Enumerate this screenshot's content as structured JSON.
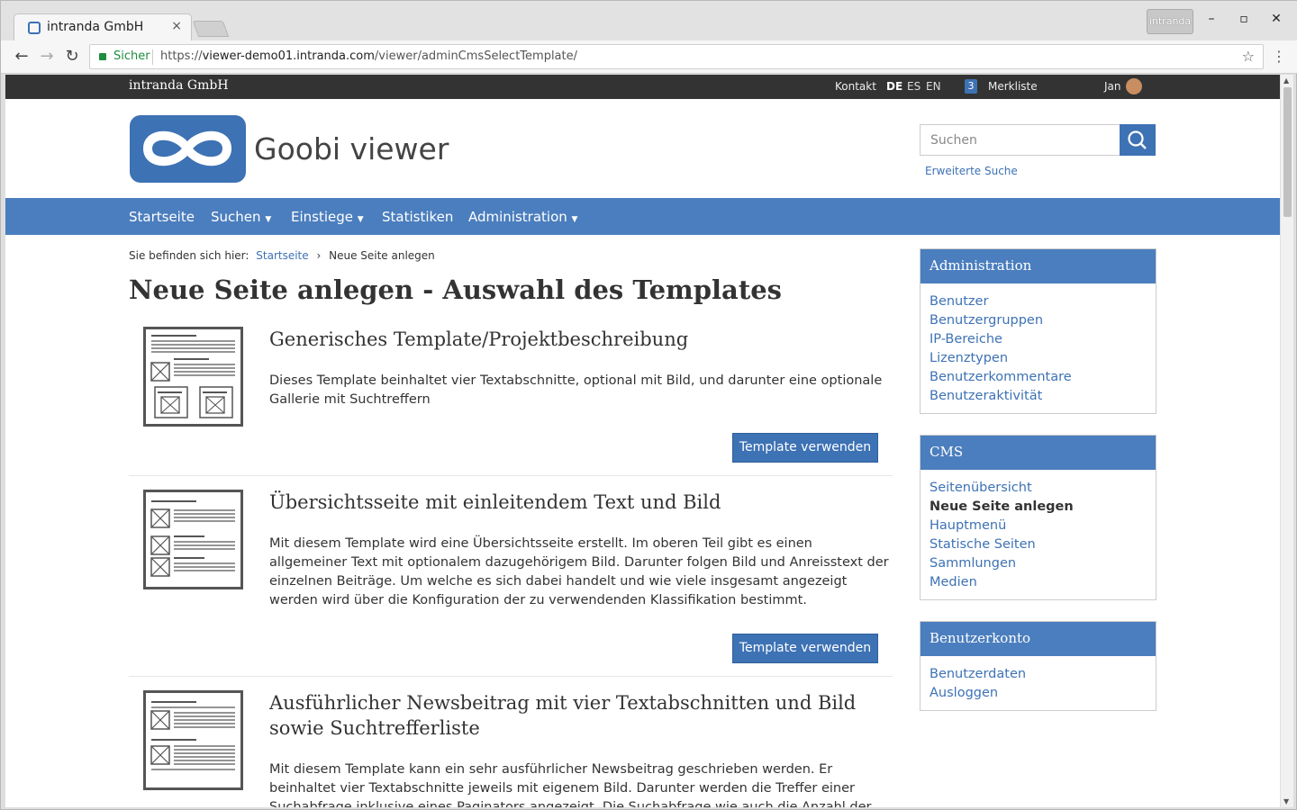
{
  "browser": {
    "tab_title": "intranda GmbH",
    "tab_close": "×",
    "profile_label": "intranda",
    "secure_label": "Sicher",
    "url_scheme": "https://",
    "url_domain": "viewer-demo01.intranda.com",
    "url_path": "/viewer/adminCmsSelectTemplate/"
  },
  "topbar": {
    "brand": "intranda GmbH",
    "contact": "Kontakt",
    "langs": [
      "DE",
      "ES",
      "EN"
    ],
    "active_lang": "DE",
    "watchlist_count": "3",
    "watchlist_label": "Merkliste",
    "user": "Jan"
  },
  "header": {
    "site_title": "Goobi viewer",
    "search_placeholder": "Suchen",
    "advanced_search": "Erweiterte Suche"
  },
  "nav": {
    "items": [
      "Startseite",
      "Suchen",
      "Einstiege",
      "Statistiken",
      "Administration"
    ]
  },
  "breadcrumb": {
    "prefix": "Sie befinden sich hier:",
    "home": "Startseite",
    "separator": "›",
    "current": "Neue Seite anlegen"
  },
  "page_title": "Neue Seite anlegen - Auswahl des Templates",
  "templates": [
    {
      "title": "Generisches Template/Projektbeschreibung",
      "description": "Dieses Template beinhaltet vier Textabschnitte, optional mit Bild, und darunter eine optionale Gallerie mit Suchtreffern",
      "button": "Template verwenden"
    },
    {
      "title": "Übersichtsseite mit einleitendem Text und Bild",
      "description": "Mit diesem Template wird eine Übersichtsseite erstellt. Im oberen Teil gibt es einen allgemeiner Text mit optionalem dazugehörigem Bild. Darunter folgen Bild und Anreisstext der einzelnen Beiträge. Um welche es sich dabei handelt und wie viele insgesamt angezeigt werden wird über die Konfiguration der zu verwendenden Klassifikation bestimmt.",
      "button": "Template verwenden"
    },
    {
      "title": "Ausführlicher Newsbeitrag mit vier Textabschnitten und Bild sowie Suchtrefferliste",
      "description": "Mit diesem Template kann ein sehr ausführlicher Newsbeitrag geschrieben werden. Er beinhaltet vier Textabschnitte jeweils mit eigenem Bild. Darunter werden die Treffer einer Suchabfrage inklusive eines Paginators angezeigt. Die Suchabfrage wie auch die Anzahl der Elemente pro"
    }
  ],
  "sidebar": {
    "admin": {
      "title": "Administration",
      "items": [
        "Benutzer",
        "Benutzergruppen",
        "IP-Bereiche",
        "Lizenztypen",
        "Benutzerkommentare",
        "Benutzeraktivität"
      ]
    },
    "cms": {
      "title": "CMS",
      "items": [
        "Seitenübersicht",
        "Neue Seite anlegen",
        "Hauptmenü",
        "Statische Seiten",
        "Sammlungen",
        "Medien"
      ],
      "current": "Neue Seite anlegen"
    },
    "account": {
      "title": "Benutzerkonto",
      "items": [
        "Benutzerdaten",
        "Ausloggen"
      ]
    }
  },
  "colors": {
    "brand_blue": "#3d72b4",
    "nav_blue": "#4b7ebe",
    "topbar_dark": "#333333"
  }
}
